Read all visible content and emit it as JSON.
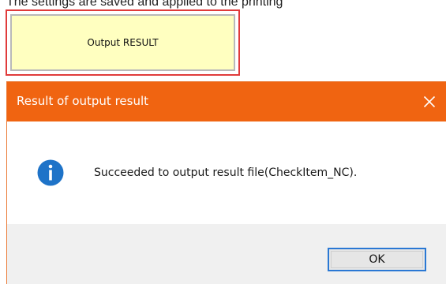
{
  "caption": {
    "text": "The settings are saved and applied to the printing"
  },
  "output_button": {
    "label": "Output RESULT",
    "background": "#ffffc0"
  },
  "dialog": {
    "title": "Result of output result",
    "close_icon": "close-icon",
    "title_bar_color": "#f06411",
    "message_icon": "info-icon",
    "message": "Succeeded to output result file(CheckItem_NC).",
    "ok_label": "OK"
  },
  "colors": {
    "highlight_frame": "#e03b3b",
    "info_icon": "#1e73c8",
    "ok_border": "#2a78d4"
  }
}
